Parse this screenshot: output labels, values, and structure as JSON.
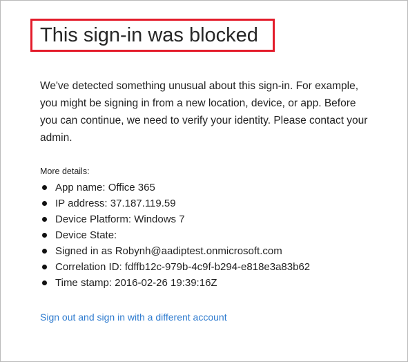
{
  "title": "This sign-in was blocked",
  "message": "We've detected something unusual about this sign-in. For example, you might be signing in from a new location, device, or app. Before you can continue, we need to verify your identity. Please contact your admin.",
  "details": {
    "heading": "More details:",
    "items": [
      "App name: Office 365",
      "IP address: 37.187.119.59",
      "Device Platform: Windows 7",
      "Device State:",
      "Signed in as Robynh@aadiptest.onmicrosoft.com",
      "Correlation ID: fdffb12c-979b-4c9f-b294-e818e3a83b62",
      "Time stamp: 2016-02-26 19:39:16Z"
    ]
  },
  "signout_link": "Sign out and sign in with a different account",
  "colors": {
    "highlight_border": "#e31b2a",
    "link": "#2e7bcf",
    "frame_border": "#b9b9b9"
  }
}
